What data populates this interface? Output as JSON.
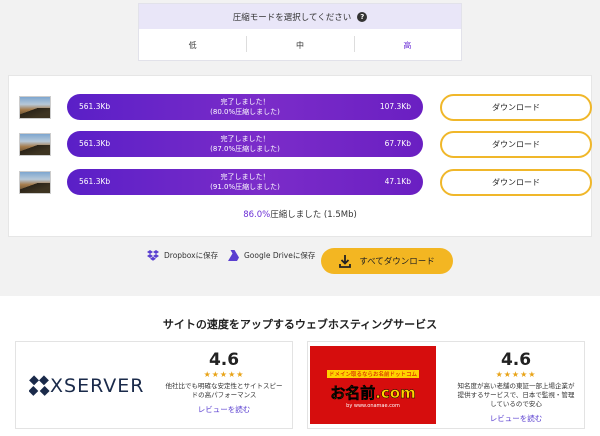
{
  "mode": {
    "title": "圧縮モードを選択してください",
    "options": [
      {
        "label": "低"
      },
      {
        "label": "中"
      },
      {
        "label": "高"
      }
    ],
    "selected": "高"
  },
  "results": {
    "rows": [
      {
        "original": "561.3Kb",
        "done": "完了しました！",
        "detail": "(80.0%圧縮しました)",
        "compressed": "107.3Kb",
        "download_label": "ダウンロード"
      },
      {
        "original": "561.3Kb",
        "done": "完了しました！",
        "detail": "(87.0%圧縮しました)",
        "compressed": "67.7Kb",
        "download_label": "ダウンロード"
      },
      {
        "original": "561.3Kb",
        "done": "完了しました！",
        "detail": "(91.0%圧縮しました)",
        "compressed": "47.1Kb",
        "download_label": "ダウンロード"
      }
    ],
    "summary_pct": "86.0%",
    "summary_text": "圧縮しました (1.5Mb)"
  },
  "actions": {
    "dropbox": "Dropboxに保存",
    "gdrive": "Google Driveに保存",
    "download_all": "すべてダウンロード"
  },
  "hosting": {
    "title": "サイトの速度をアップするウェブホスティングサービス",
    "cards": [
      {
        "logo": "XSERVER",
        "score": "4.6",
        "stars": "★★★★★",
        "desc": "他社比でも明確な安定性とサイトスピードの高パフォーマンス",
        "review": "レビューを読む"
      },
      {
        "logo_top": "ドメイン取るならお名前ドットコム",
        "logo": "お名前.com",
        "logo_sub": "by www.onamae.com",
        "score": "4.6",
        "stars": "★★★★★",
        "desc": "知名度が高い老舗の東証一部上場企業が提供するサービスで、日本で監視・管理しているので安心",
        "review": "レビューを読む"
      }
    ]
  },
  "colors": {
    "accent": "#6b2fd6",
    "button": "#f3b622",
    "bar": "#6a22c8"
  }
}
